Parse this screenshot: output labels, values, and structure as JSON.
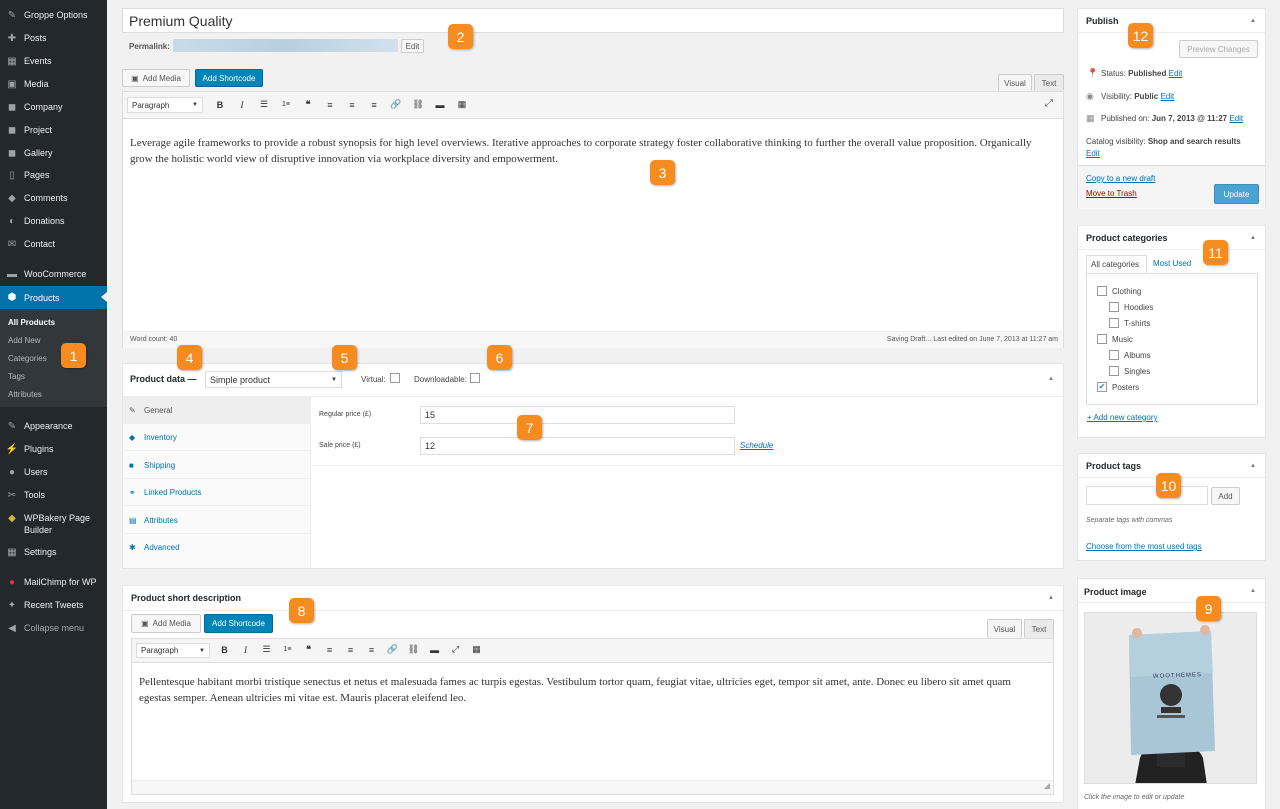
{
  "sidebar": {
    "items": [
      {
        "label": "Groppe Options",
        "icon": "brush-icon",
        "glyph": "✎"
      },
      {
        "label": "Posts",
        "icon": "pin-icon",
        "glyph": "✚"
      },
      {
        "label": "Events",
        "icon": "calendar-icon",
        "glyph": "▦"
      },
      {
        "label": "Media",
        "icon": "media-icon",
        "glyph": "▣"
      },
      {
        "label": "Company",
        "icon": "briefcase-icon",
        "glyph": "◼"
      },
      {
        "label": "Project",
        "icon": "project-icon",
        "glyph": "◼"
      },
      {
        "label": "Gallery",
        "icon": "gallery-icon",
        "glyph": "◼"
      },
      {
        "label": "Pages",
        "icon": "pages-icon",
        "glyph": "▯"
      },
      {
        "label": "Comments",
        "icon": "comments-icon",
        "glyph": "◆"
      },
      {
        "label": "Donations",
        "icon": "donations-icon",
        "glyph": "◐"
      },
      {
        "label": "Contact",
        "icon": "mail-icon",
        "glyph": "✉"
      },
      {
        "label": "WooCommerce",
        "icon": "woo-icon",
        "glyph": "▬"
      },
      {
        "label": "Products",
        "icon": "products-icon",
        "glyph": "⬢"
      },
      {
        "label": "Appearance",
        "icon": "appearance-icon",
        "glyph": "✎"
      },
      {
        "label": "Plugins",
        "icon": "plugins-icon",
        "glyph": "⚡"
      },
      {
        "label": "Users",
        "icon": "users-icon",
        "glyph": "●"
      },
      {
        "label": "Tools",
        "icon": "tools-icon",
        "glyph": "✂"
      },
      {
        "label": "WPBakery Page",
        "label2": "Builder",
        "icon": "wpbakery-icon",
        "glyph": "◆"
      },
      {
        "label": "Settings",
        "icon": "settings-icon",
        "glyph": "▦"
      },
      {
        "label": "MailChimp for WP",
        "icon": "mailchimp-icon",
        "glyph": "●"
      },
      {
        "label": "Recent Tweets",
        "icon": "twitter-icon",
        "glyph": "✦"
      },
      {
        "label": "Collapse menu",
        "icon": "collapse-icon",
        "glyph": "◀"
      }
    ],
    "submenu": [
      "All Products",
      "Add New",
      "Categories",
      "Tags",
      "Attributes"
    ]
  },
  "post": {
    "title": "Premium Quality",
    "permalink_label": "Permalink:",
    "edit_label": "Edit",
    "add_media": "Add Media",
    "add_shortcode": "Add Shortcode",
    "tab_visual": "Visual",
    "tab_text": "Text",
    "format_select": "Paragraph",
    "content": "Leverage agile frameworks to provide a robust synopsis for high level overviews. Iterative approaches to corporate strategy foster collaborative thinking to further the overall value proposition. Organically grow the holistic world view of disruptive innovation via workplace diversity and empowerment.",
    "word_count": "Word count: 40",
    "saving": "Saving Draft... Last edited on June 7, 2013 at 11:27 am"
  },
  "product_data": {
    "label": "Product data —",
    "type": "Simple product",
    "virtual": "Virtual:",
    "downloadable": "Downloadable:",
    "tabs": [
      "General",
      "Inventory",
      "Shipping",
      "Linked Products",
      "Attributes",
      "Advanced"
    ],
    "regular_price_label": "Regular price (£)",
    "regular_price": "15",
    "sale_price_label": "Sale price (£)",
    "sale_price": "12",
    "schedule": "Schedule"
  },
  "short_desc": {
    "title": "Product short description",
    "add_media": "Add Media",
    "add_shortcode": "Add Shortcode",
    "tab_visual": "Visual",
    "tab_text": "Text",
    "format_select": "Paragraph",
    "content": "Pellentesque habitant morbi tristique senectus et netus et malesuada fames ac turpis egestas. Vestibulum tortor quam, feugiat vitae, ultricies eget, tempor sit amet, ante. Donec eu libero sit amet quam egestas semper. Aenean ultricies mi vitae est. Mauris placerat eleifend leo."
  },
  "publish": {
    "title": "Publish",
    "preview": "Preview Changes",
    "status_label": "Status:",
    "status": "Published",
    "visibility_label": "Visibility:",
    "visibility": "Public",
    "published_label": "Published on:",
    "published": "Jun 7, 2013 @ 11:27",
    "catalog_label": "Catalog visibility:",
    "catalog": "Shop and search results",
    "edit": "Edit",
    "copy": "Copy to a new draft",
    "trash": "Move to Trash",
    "update": "Update"
  },
  "categories": {
    "title": "Product categories",
    "tab_all": "All categories",
    "tab_most": "Most Used",
    "items": [
      "Clothing",
      "Hoodies",
      "T-shirts",
      "Music",
      "Albums",
      "Singles",
      "Posters"
    ],
    "add_new": "+ Add new category"
  },
  "tags": {
    "title": "Product tags",
    "add": "Add",
    "hint": "Separate tags with commas",
    "choose": "Choose from the most used tags"
  },
  "image": {
    "title": "Product image",
    "poster_text": "WOOTHEMES",
    "caption": "Click the image to edit or update"
  },
  "badges": [
    "1",
    "2",
    "3",
    "4",
    "5",
    "6",
    "7",
    "8",
    "9",
    "10",
    "11",
    "12"
  ],
  "colors": {
    "accent": "#0073aa",
    "badge": "#f68b1f",
    "sidebar": "#23282d"
  }
}
